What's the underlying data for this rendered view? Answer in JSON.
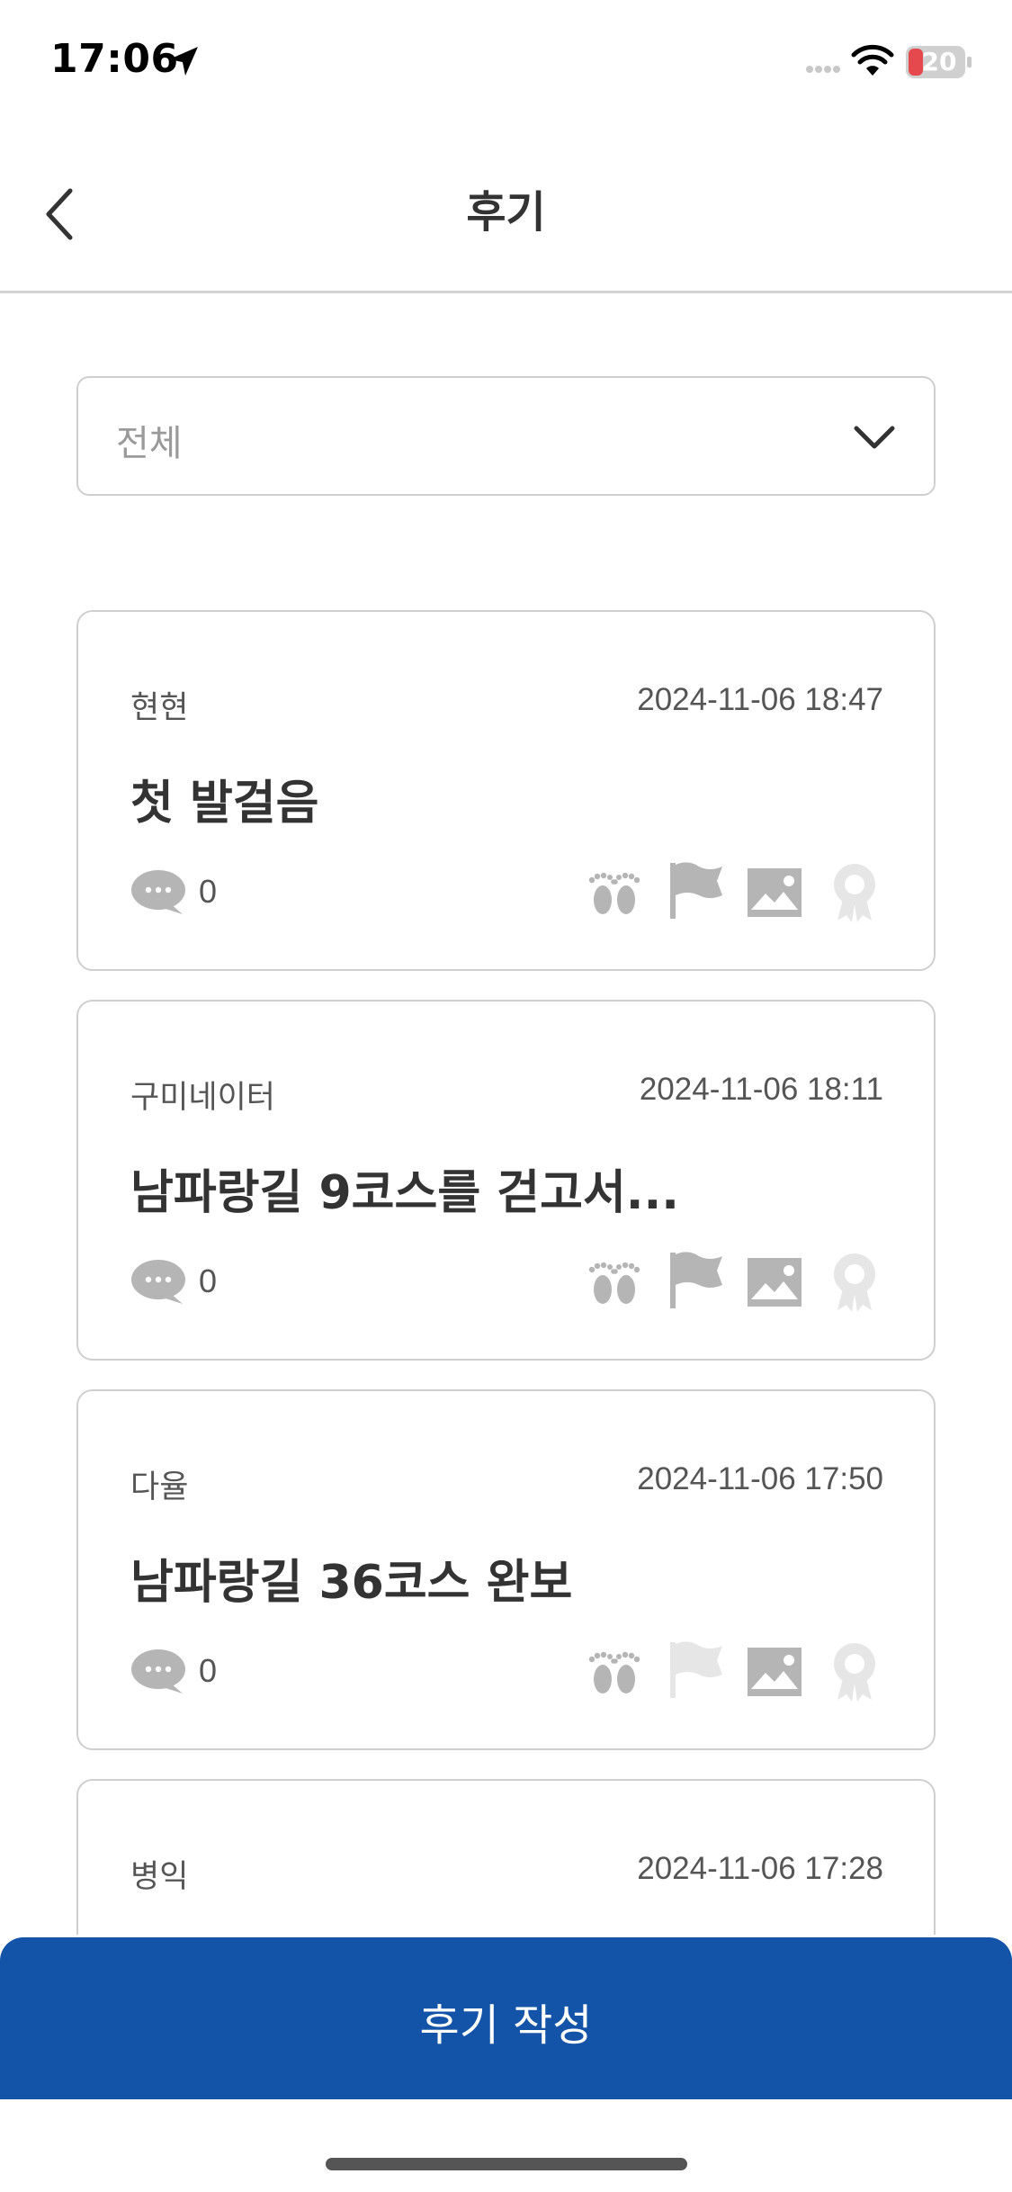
{
  "status_bar": {
    "time": "17:06",
    "battery": "20"
  },
  "header": {
    "title": "후기"
  },
  "filter": {
    "value": "전체"
  },
  "reviews": [
    {
      "author": "현현",
      "date": "2024-11-06 18:47",
      "title": "첫 발걸음",
      "comments": "0"
    },
    {
      "author": "구미네이터",
      "date": "2024-11-06 18:11",
      "title": "남파랑길 9코스를 걷고서...",
      "comments": "0"
    },
    {
      "author": "다율",
      "date": "2024-11-06 17:50",
      "title": "남파랑길 36코스 완보",
      "comments": "0"
    },
    {
      "author": "병익",
      "date": "2024-11-06 17:28",
      "title": "",
      "comments": ""
    }
  ],
  "write_button": {
    "label": "후기 작성"
  },
  "colors": {
    "primary": "#1354a8",
    "icon_active": "#b5b5b5",
    "icon_inactive": "#e6e6e6",
    "battery_low": "#e5484d"
  }
}
